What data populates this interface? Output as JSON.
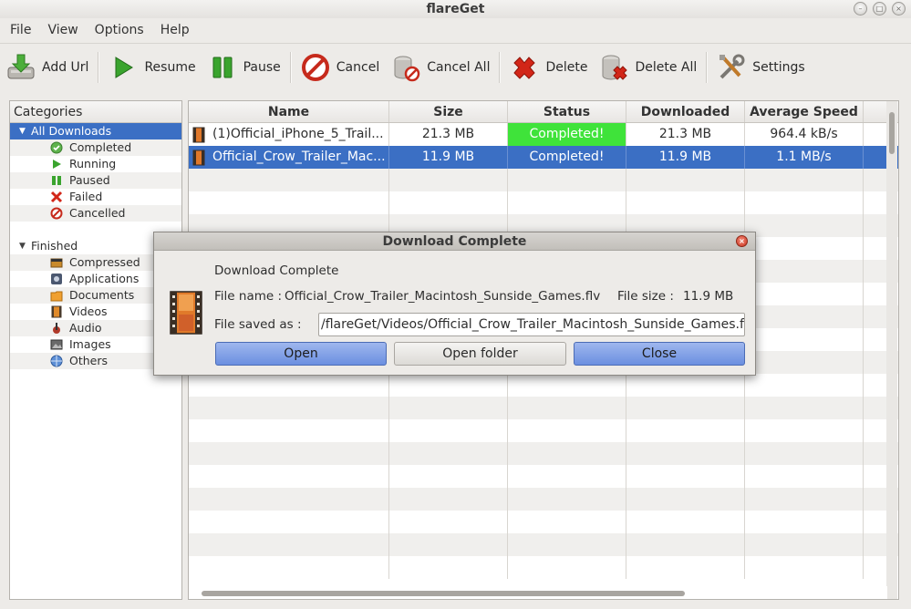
{
  "window": {
    "title": "flareGet"
  },
  "menu": [
    "File",
    "View",
    "Options",
    "Help"
  ],
  "toolbar": [
    {
      "label": "Add Url",
      "icon": "add-url-icon"
    },
    {
      "label": "Resume",
      "icon": "play-icon"
    },
    {
      "label": "Pause",
      "icon": "pause-icon"
    },
    {
      "label": "Cancel",
      "icon": "cancel-icon"
    },
    {
      "label": "Cancel All",
      "icon": "cancel-all-icon"
    },
    {
      "label": "Delete",
      "icon": "delete-icon"
    },
    {
      "label": "Delete All",
      "icon": "delete-all-icon"
    },
    {
      "label": "Settings",
      "icon": "settings-icon"
    }
  ],
  "sidebar": {
    "header": "Categories",
    "all_downloads": "All Downloads",
    "status_items": [
      "Completed",
      "Running",
      "Paused",
      "Failed",
      "Cancelled"
    ],
    "finished": "Finished",
    "finished_items": [
      "Compressed",
      "Applications",
      "Documents",
      "Videos",
      "Audio",
      "Images",
      "Others"
    ]
  },
  "table": {
    "headers": [
      "Name",
      "Size",
      "Status",
      "Downloaded",
      "Average Speed"
    ],
    "rows": [
      {
        "name": "(1)Official_iPhone_5_Trail...",
        "size": "21.3 MB",
        "status": "Completed!",
        "downloaded": "21.3 MB",
        "speed": "964.4 kB/s"
      },
      {
        "name": "Official_Crow_Trailer_Mac...",
        "size": "11.9 MB",
        "status": "Completed!",
        "downloaded": "11.9 MB",
        "speed": "1.1 MB/s"
      }
    ]
  },
  "dialog": {
    "title": "Download Complete",
    "heading": "Download Complete",
    "file_name_label": "File name :",
    "file_name": "Official_Crow_Trailer_Macintosh_Sunside_Games.flv",
    "file_size_label": "File size :",
    "file_size": "11.9 MB",
    "saved_as_label": "File saved as :",
    "saved_as": "/flareGet/Videos/Official_Crow_Trailer_Macintosh_Sunside_Games.flv",
    "buttons": {
      "open": "Open",
      "open_folder": "Open folder",
      "close": "Close"
    }
  },
  "colors": {
    "selection": "#3b6fc4",
    "status_completed": "#3fe33a"
  }
}
